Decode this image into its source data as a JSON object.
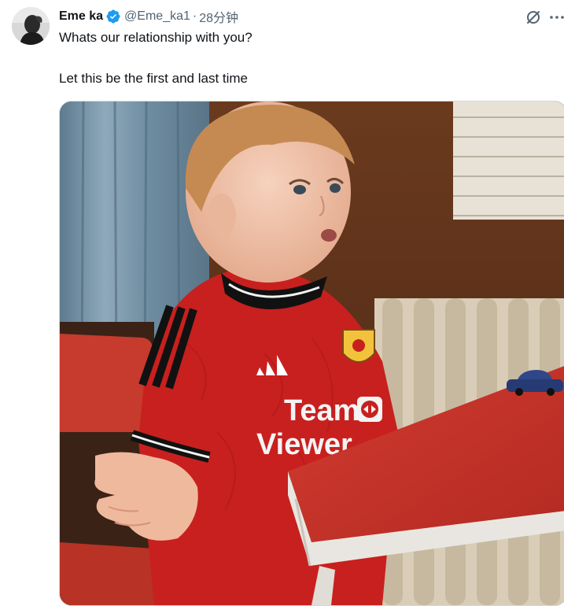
{
  "tweet": {
    "author_name": "Eme ka",
    "handle": "@Eme_ka1",
    "separator": "·",
    "time": "28分钟",
    "verified": true,
    "text_line1": "Whats our relationship with you?",
    "text_line2": "Let this be the first and last time"
  },
  "media": {
    "jersey_brand": "Team",
    "jersey_brand2": "Viewer",
    "shirt_color": "#c8201e"
  },
  "icons": {
    "grok": "grok-icon",
    "more": "more-icon",
    "verified": "verified-badge-icon"
  },
  "colors": {
    "accent": "#1d9bf0",
    "secondary_text": "#536471"
  }
}
